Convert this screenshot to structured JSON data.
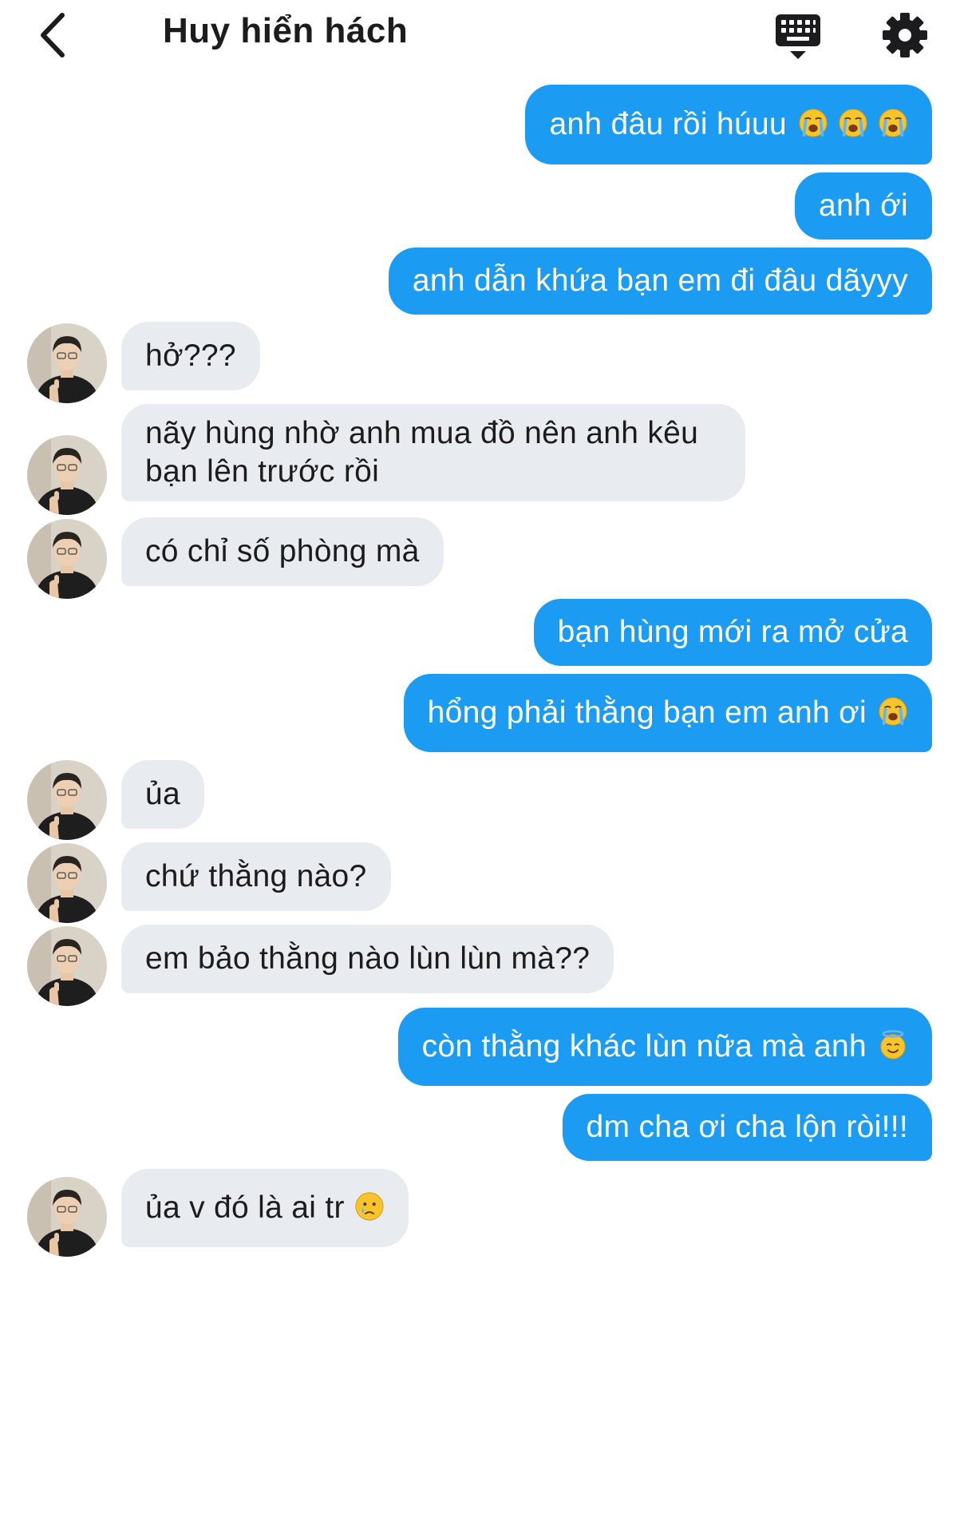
{
  "header": {
    "title": "Huy hiển hách"
  },
  "colors": {
    "outgoing_bubble": "#1b9cf2",
    "incoming_bubble": "#e8ebef",
    "text_dark": "#1c1c1e",
    "text_light": "#ffffff"
  },
  "messages": [
    {
      "direction": "out",
      "text": "anh đâu rồi húuu",
      "emoji": [
        "loudly-crying-face",
        "loudly-crying-face",
        "loudly-crying-face"
      ]
    },
    {
      "direction": "out",
      "text": "anh ới"
    },
    {
      "direction": "out",
      "text": "anh dẫn khứa bạn em đi đâu dãyyy"
    },
    {
      "direction": "in",
      "text": "hở???"
    },
    {
      "direction": "in",
      "text": "nãy hùng nhờ anh mua đồ nên anh kêu bạn lên trước rồi"
    },
    {
      "direction": "in",
      "text": "có chỉ số phòng mà"
    },
    {
      "direction": "out",
      "text": "bạn hùng mới ra mở cửa"
    },
    {
      "direction": "out",
      "text": "hổng phải thằng bạn em anh ơi",
      "emoji": [
        "loudly-crying-face"
      ]
    },
    {
      "direction": "in",
      "text": "ủa"
    },
    {
      "direction": "in",
      "text": "chứ thằng nào?"
    },
    {
      "direction": "in",
      "text": "em bảo thằng nào lùn lùn mà??"
    },
    {
      "direction": "out",
      "text": "còn thằng khác lùn nữa mà anh",
      "emoji": [
        "smiling-face-with-halo"
      ]
    },
    {
      "direction": "out",
      "text": "dm cha ơi cha lộn ròi!!!"
    },
    {
      "direction": "in",
      "text": "ủa v đó là ai tr",
      "emoji": [
        "crying-face"
      ]
    }
  ]
}
